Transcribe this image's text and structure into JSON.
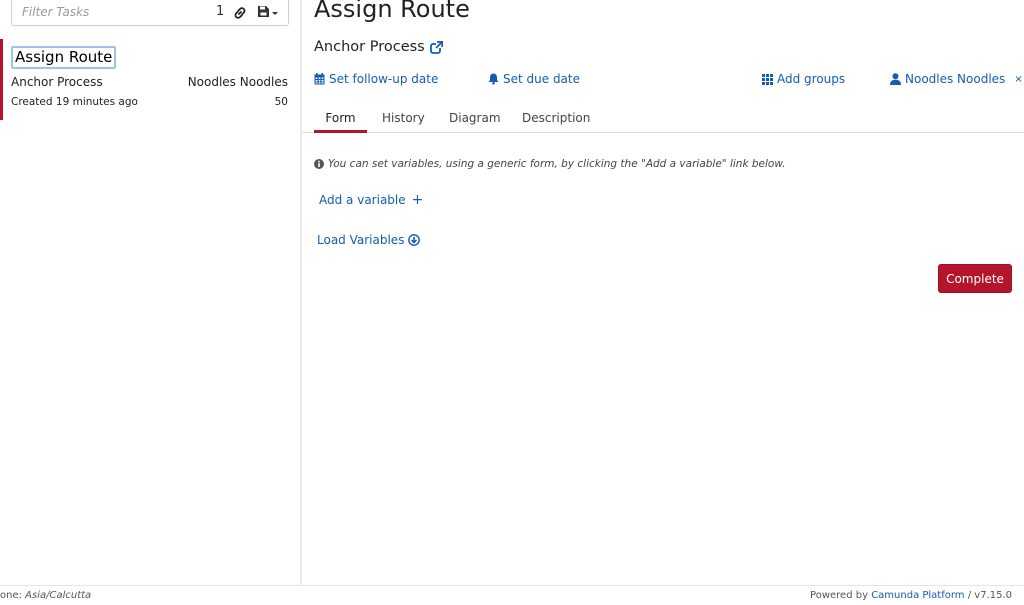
{
  "sidebar": {
    "filter": {
      "placeholder": "Filter Tasks",
      "count": "1",
      "link_icon": "link-icon",
      "save_icon": "floppy-disk-icon"
    },
    "tasks": [
      {
        "name": "Assign Route",
        "process": "Anchor Process",
        "assignee": "Noodles Noodles",
        "created": "Created 19 minutes ago",
        "priority": "50"
      }
    ]
  },
  "main": {
    "title": "Assign Route",
    "process_name": "Anchor Process",
    "actions": {
      "followup": "Set follow-up date",
      "due_date": "Set due date",
      "add_groups": "Add groups",
      "assignee": "Noodles Noodles",
      "remove": "×"
    },
    "tabs": [
      {
        "label": "Form",
        "active": true
      },
      {
        "label": "History",
        "active": false
      },
      {
        "label": "Diagram",
        "active": false
      },
      {
        "label": "Description",
        "active": false
      }
    ],
    "info_text": "You can set variables, using a generic form, by clicking the \"Add a variable\" link below.",
    "add_variable": "Add a variable",
    "add_variable_symbol": "+",
    "load_variables": "Load Variables",
    "complete_button": "Complete"
  },
  "footer": {
    "timezone_label": "one: ",
    "timezone_value": "Asia/Calcutta",
    "powered_by": "Powered by ",
    "brand": "Camunda Platform",
    "version": " / v7.15.0"
  },
  "colors": {
    "accent": "#b5152b",
    "link": "#155cb5",
    "focus_outline": "#9ec3ea"
  }
}
